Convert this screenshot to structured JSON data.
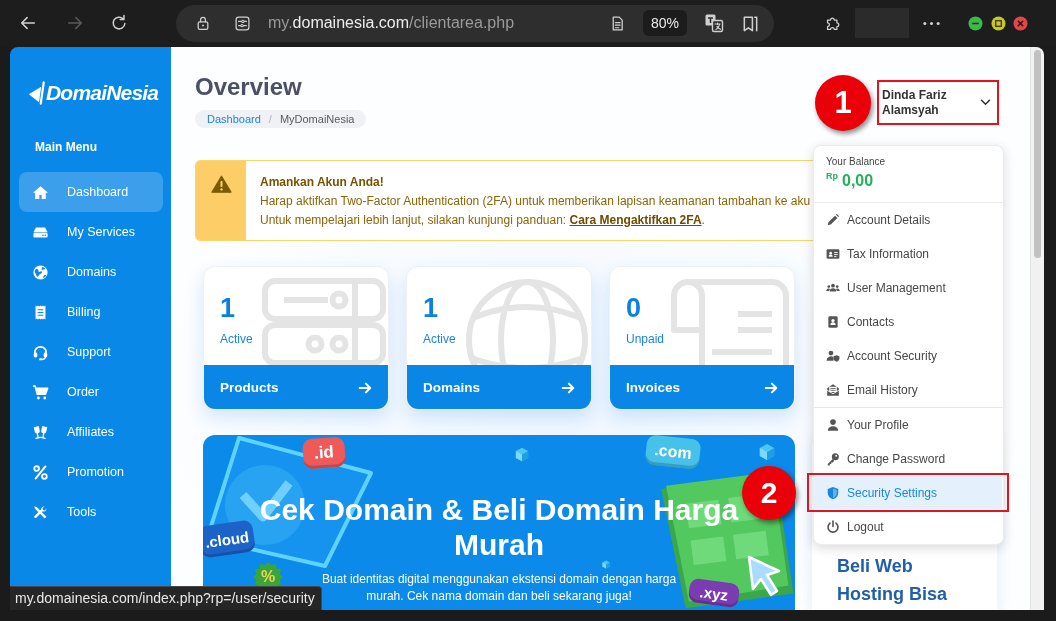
{
  "browser": {
    "nav_buttons": [
      {
        "kind": "back",
        "disabled": false
      },
      {
        "kind": "forward",
        "disabled": true
      },
      {
        "kind": "reload",
        "disabled": false
      }
    ],
    "url": {
      "subdomain": "my.",
      "domain": "domainesia.com",
      "path": "/clientarea.php"
    },
    "zoom": "80%"
  },
  "sidebar": {
    "logo": "DomaiNesia",
    "heading": "Main Menu",
    "items": [
      {
        "label": "Dashboard",
        "selected": true
      },
      {
        "label": "My Services",
        "selected": false
      },
      {
        "label": "Domains",
        "selected": false
      },
      {
        "label": "Billing",
        "selected": false
      },
      {
        "label": "Support",
        "selected": false
      },
      {
        "label": "Order",
        "selected": false
      },
      {
        "label": "Affiliates",
        "selected": false
      },
      {
        "label": "Promotion",
        "selected": false
      },
      {
        "label": "Tools",
        "selected": false
      }
    ]
  },
  "header": {
    "title": "Overview",
    "breadcrumb": {
      "separator": "/",
      "items": [
        {
          "label": "Dashboard",
          "link": true
        },
        {
          "label": "MyDomaiNesia",
          "link": false
        }
      ]
    }
  },
  "user_menu": {
    "name": "Dinda Fariz Alamsyah",
    "highlighted": true,
    "marker": "1",
    "expanded": true,
    "dropdown": {
      "balance_label": "Your Balance",
      "currency": "Rp",
      "balance": "0,00",
      "sections": [
        {
          "items": [
            {
              "label": "Account Details",
              "selected": false,
              "highlighted": false
            },
            {
              "label": "Tax Information",
              "selected": false,
              "highlighted": false
            },
            {
              "label": "User Management",
              "selected": false,
              "highlighted": false
            },
            {
              "label": "Contacts",
              "selected": false,
              "highlighted": false
            },
            {
              "label": "Account Security",
              "selected": false,
              "highlighted": false
            },
            {
              "label": "Email History",
              "selected": false,
              "highlighted": false
            }
          ]
        },
        {
          "items": [
            {
              "label": "Your Profile",
              "selected": false,
              "highlighted": false
            },
            {
              "label": "Change Password",
              "selected": false,
              "highlighted": false
            },
            {
              "label": "Security Settings",
              "selected": true,
              "highlighted": true,
              "marker": "2"
            },
            {
              "label": "Logout",
              "selected": false,
              "highlighted": false
            }
          ]
        }
      ]
    }
  },
  "alert": {
    "title": "Amankan Akun Anda!",
    "message": "Harap aktifkan Two-Factor Authentication (2FA) untuk memberikan lapisan keamanan tambahan ke aku",
    "guide_text": "Untuk mempelajari lebih lanjut, silakan kunjungi panduan: ",
    "guide_link": "Cara Mengaktifkan 2FA",
    "guide_end": "."
  },
  "stats": [
    {
      "count": "1",
      "status": "Active",
      "label": "Products"
    },
    {
      "count": "1",
      "status": "Active",
      "label": "Domains"
    },
    {
      "count": "0",
      "status": "Unpaid",
      "label": "Invoices"
    }
  ],
  "banner": {
    "title": "Cek Domain & Beli Domain Harga Murah",
    "subtitle": "Buat identitas digital menggunakan ekstensi domain dengan harga murah. Cek nama domain dan beli sekarang juga!",
    "tags": [
      {
        "kind": "domain",
        "label": ".id",
        "color": "#ee5a5a"
      },
      {
        "kind": "domain",
        "label": ".cloud",
        "color": "#1c63c8"
      },
      {
        "kind": "domain",
        "label": ".com",
        "color": "#45c1ea"
      },
      {
        "kind": "domain",
        "label": ".xyz",
        "color": "#7a3cb0"
      },
      {
        "kind": "discount",
        "label": "%",
        "color": "#3aa53a"
      }
    ]
  },
  "side_promo": {
    "heading": "Beli Web Hosting Bisa"
  },
  "status_url": "my.domainesia.com/index.php?rp=/user/security"
}
